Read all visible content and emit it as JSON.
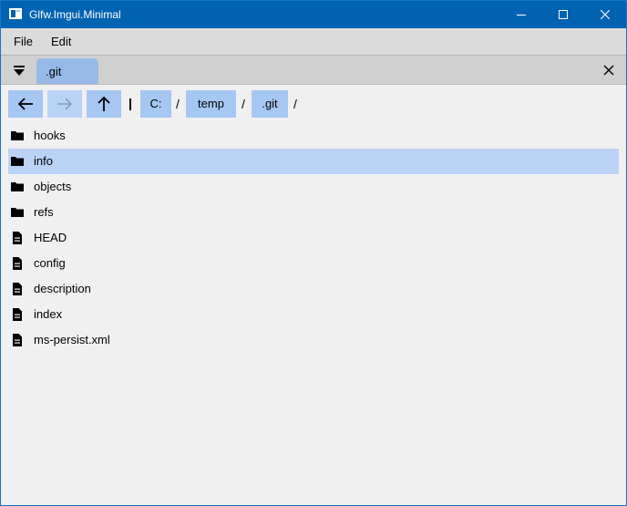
{
  "window": {
    "title": "Glfw.Imgui.Minimal",
    "titlebar_color": "#0063b1"
  },
  "menu": {
    "file_label": "File",
    "edit_label": "Edit"
  },
  "tabbar": {
    "active_tab_label": ".git",
    "tab_color": "#97b9e8"
  },
  "breadcrumb": {
    "parts": [
      "C:",
      "temp",
      ".git"
    ],
    "separator": "/",
    "button_color": "#a6c7f2"
  },
  "files": {
    "items": [
      {
        "name": "hooks",
        "type": "folder",
        "icon": "folder-icon",
        "selected": false
      },
      {
        "name": "info",
        "type": "folder",
        "icon": "folder-icon",
        "selected": true
      },
      {
        "name": "objects",
        "type": "folder",
        "icon": "folder-icon",
        "selected": false
      },
      {
        "name": "refs",
        "type": "folder",
        "icon": "folder-icon",
        "selected": false
      },
      {
        "name": "HEAD",
        "type": "file",
        "icon": "file-icon",
        "selected": false
      },
      {
        "name": "config",
        "type": "file",
        "icon": "file-icon",
        "selected": false
      },
      {
        "name": "description",
        "type": "file",
        "icon": "file-icon",
        "selected": false
      },
      {
        "name": "index",
        "type": "file",
        "icon": "file-icon",
        "selected": false
      },
      {
        "name": "ms-persist.xml",
        "type": "file",
        "icon": "file-icon",
        "selected": false
      }
    ],
    "selection_color": "#bad3f5"
  }
}
